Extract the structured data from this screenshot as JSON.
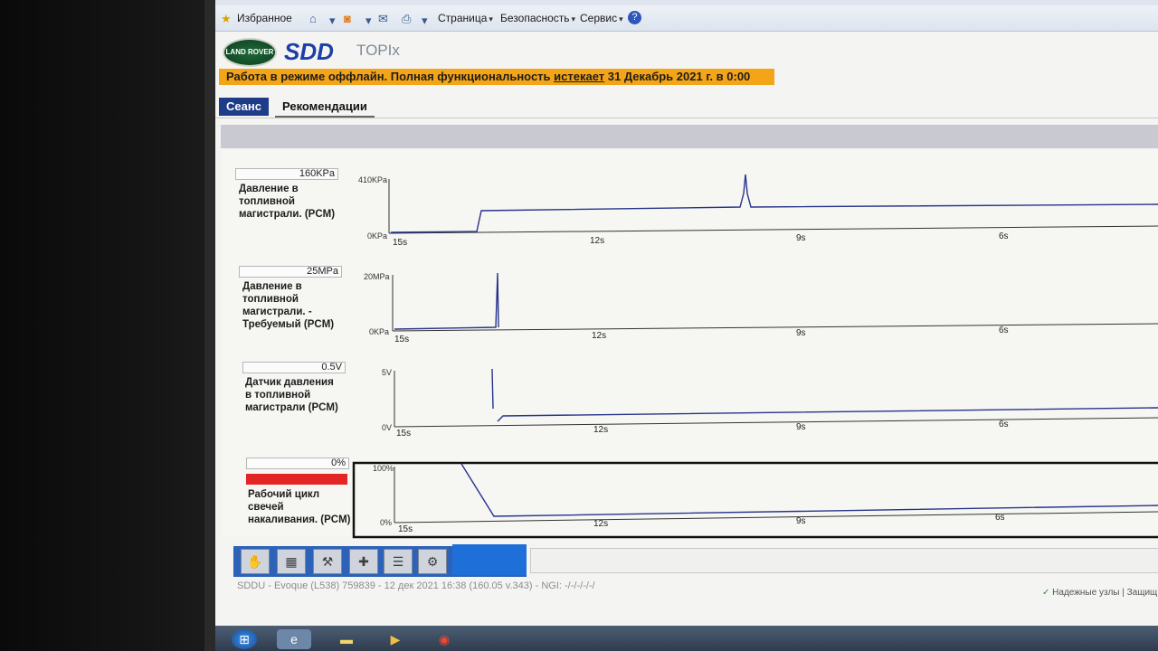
{
  "ie_toolbar": {
    "favorites": "Избранное",
    "page": "Страница",
    "security": "Безопасность",
    "service": "Сервис",
    "icons": [
      "star-icon",
      "home-icon",
      "rss-icon",
      "mail-icon",
      "print-icon",
      "help-icon"
    ]
  },
  "header": {
    "logo_text": "LAND ROVER",
    "brand": "SDD",
    "product": "TOPIx",
    "banner_prefix": "Работа в режиме оффлайн. Полная функциональность ",
    "banner_underlined": "истекает",
    "banner_suffix": " 31 Декабрь 2021 г. в 0:00",
    "banner_color": "#f4a417"
  },
  "tabs": {
    "session": "Сеанс",
    "recommendations": "Рекомендации"
  },
  "channels": [
    {
      "value": "160KPa",
      "label_lines": [
        "Давление в",
        "топливной",
        "магистрали. (PCM)"
      ],
      "y_max": "410KPa",
      "y_min": "0KPa"
    },
    {
      "value": "25MPa",
      "label_lines": [
        "Давление в",
        "топливной",
        "магистрали. -",
        "Требуемый (PCM)"
      ],
      "y_max": "20MPa",
      "y_min": "0KPa"
    },
    {
      "value": "0.5V",
      "label_lines": [
        "Датчик давления",
        "в топливной",
        "магистрали (PCM)"
      ],
      "y_max": "5V",
      "y_min": "0V"
    },
    {
      "value": "0%",
      "label_lines": [
        "Рабочий цикл",
        "свечей",
        "накаливания. (PCM)"
      ],
      "y_max": "100%",
      "y_min": "0%",
      "bar_color": "#e32525"
    }
  ],
  "time_labels": [
    "15s",
    "12s",
    "9s",
    "6s"
  ],
  "status": {
    "line": "SDDU - Evoque (L538) 759839 - 12 дек 2021 16:38 (160.05 v.343) - NGI: -/-/-/-/-/",
    "secure": "Надежные узлы | Защищ"
  },
  "toolbar_icons": [
    "vehicle-select-icon",
    "data-logger-icon",
    "tools-icon",
    "network-icon",
    "settings-icon",
    "recorder-icon"
  ],
  "colors": {
    "accent": "#1e3c88",
    "trace": "#27348b",
    "toolbar": "#2c62b8"
  }
}
